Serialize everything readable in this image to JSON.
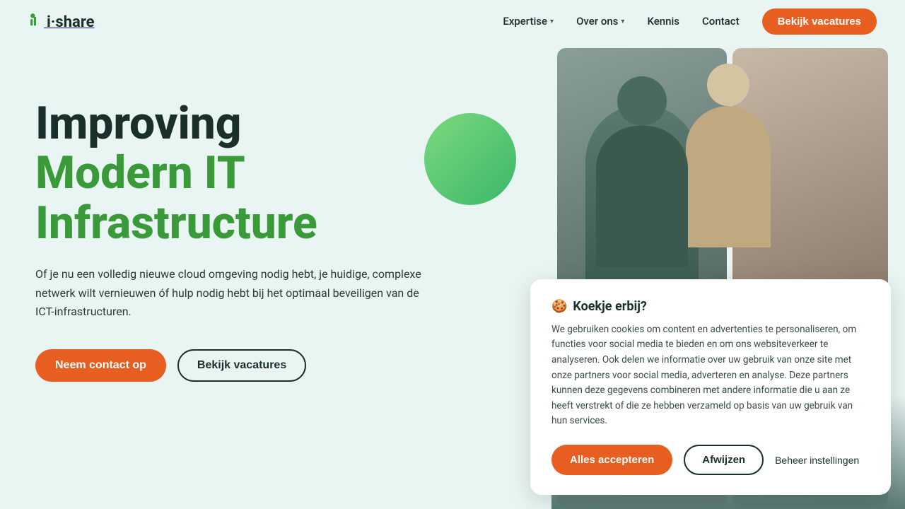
{
  "logo": {
    "text": "i·share"
  },
  "nav": {
    "items": [
      {
        "label": "Expertise",
        "hasDropdown": true
      },
      {
        "label": "Over ons",
        "hasDropdown": true
      },
      {
        "label": "Kennis",
        "hasDropdown": false
      },
      {
        "label": "Contact",
        "hasDropdown": false
      }
    ],
    "cta_label": "Bekijk vacatures"
  },
  "hero": {
    "title_line1": "Improving",
    "title_line2": "Modern IT",
    "title_line3": "Infrastructure",
    "description": "Of je nu een volledig nieuwe cloud omgeving nodig hebt, je huidige, complexe netwerk wilt vernieuwen óf hulp nodig hebt bij het optimaal beveiligen van de ICT-infrastructuren.",
    "btn_contact": "Neem contact op",
    "btn_vacatures": "Bekijk vacatures"
  },
  "cookie": {
    "title": "Koekje erbij?",
    "emoji": "🍪",
    "text": "We gebruiken cookies om content en advertenties te personaliseren, om functies voor social media te bieden en om ons websiteverkeer te analyseren. Ook delen we informatie over uw gebruik van onze site met onze partners voor social media, adverteren en analyse. Deze partners kunnen deze gegevens combineren met andere informatie die u aan ze heeft verstrekt of die ze hebben verzameld op basis van uw gebruik van hun services.",
    "btn_accept": "Alles accepteren",
    "btn_decline": "Afwijzen",
    "btn_settings": "Beheer instellingen"
  }
}
